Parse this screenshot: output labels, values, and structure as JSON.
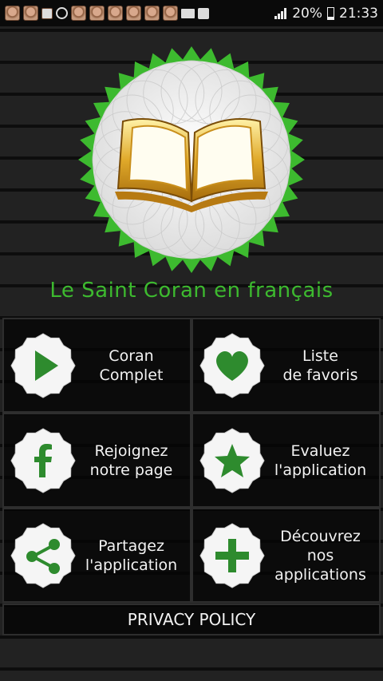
{
  "status_bar": {
    "battery": "20%",
    "time": "21:33",
    "notification_icons": [
      "avatar-icon",
      "avatar-icon",
      "gallery-icon",
      "sync-icon",
      "avatar-icon",
      "avatar-icon",
      "avatar-icon",
      "avatar-icon",
      "avatar-icon",
      "avatar-icon",
      "mail-icon",
      "facebook-icon"
    ]
  },
  "app_title": "Le Saint Coran en français",
  "menu": [
    {
      "line1": "Coran",
      "line2": "Complet",
      "line3": "",
      "icon": "play-icon"
    },
    {
      "line1": "Liste",
      "line2": "de favoris",
      "line3": "",
      "icon": "heart-icon"
    },
    {
      "line1": "Rejoignez",
      "line2": "notre page",
      "line3": "",
      "icon": "facebook-icon"
    },
    {
      "line1": "Evaluez",
      "line2": "l'application",
      "line3": "",
      "icon": "star-icon"
    },
    {
      "line1": "Partagez",
      "line2": "l'application",
      "line3": "",
      "icon": "share-icon"
    },
    {
      "line1": "Découvrez",
      "line2": "nos",
      "line3": "applications",
      "icon": "plus-icon"
    }
  ],
  "privacy_label": "PRIVACY POLICY",
  "colors": {
    "accent": "#3dba2f",
    "icon_green": "#2e8b2e"
  }
}
